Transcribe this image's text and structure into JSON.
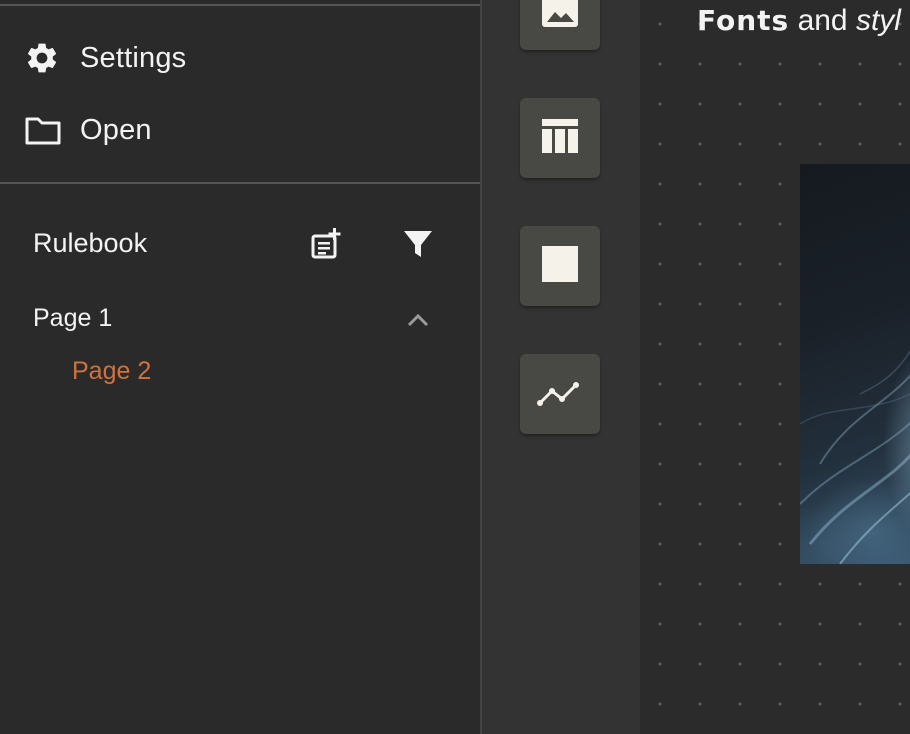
{
  "menu": {
    "settings_label": "Settings",
    "open_label": "Open"
  },
  "rulebook": {
    "title": "Rulebook",
    "pages": [
      {
        "label": "Page 1",
        "expanded": true
      },
      {
        "label": "Page 2",
        "selected": true
      }
    ]
  },
  "tools": [
    {
      "name": "image-tool",
      "icon": "image-icon"
    },
    {
      "name": "table-tool",
      "icon": "table-icon"
    },
    {
      "name": "rectangle-tool",
      "icon": "rectangle-icon"
    },
    {
      "name": "line-chart-tool",
      "icon": "line-chart-icon"
    }
  ],
  "canvas": {
    "heading_display": "Fonts",
    "heading_and": "and",
    "heading_styl": "styl"
  },
  "colors": {
    "accent": "#d0723f",
    "text": "#f3f3f3",
    "panel": "#2a2a2a",
    "tool_bg": "#484844"
  }
}
